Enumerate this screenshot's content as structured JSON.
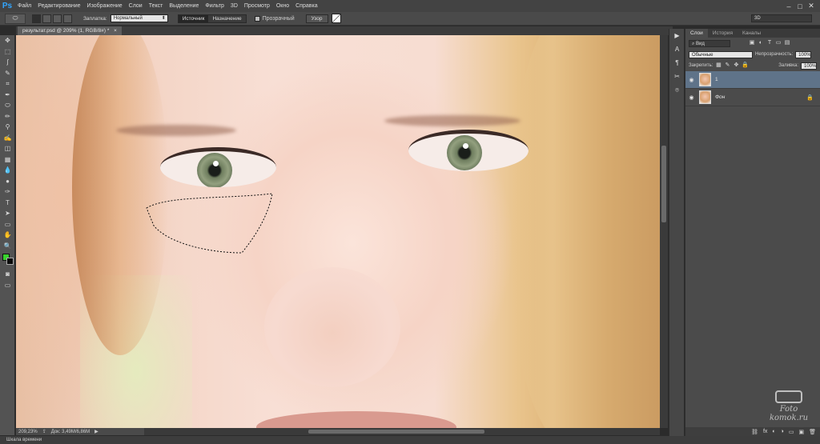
{
  "app": {
    "logo": "Ps"
  },
  "menu": [
    "Файл",
    "Редактирование",
    "Изображение",
    "Слои",
    "Текст",
    "Выделение",
    "Фильтр",
    "3D",
    "Просмотр",
    "Окно",
    "Справка"
  ],
  "window_controls": {
    "minimize": "–",
    "maximize": "□",
    "close": "✕"
  },
  "options": {
    "patch_label": "Заплатка:",
    "patch_mode": "Нормальный",
    "source": "Источник",
    "destination": "Назначение",
    "transparent": "Прозрачный",
    "pattern": "Узор",
    "workspace": "3D"
  },
  "document": {
    "tab_title": "результат.psd @ 209% (1, RGB/8#) *",
    "close": "×"
  },
  "status": {
    "zoom": "209,23%",
    "doc_size": "Док: 3,49M/6,86M",
    "arrow": "▶"
  },
  "timeline": {
    "label": "Шкала времени"
  },
  "layers_panel": {
    "tabs": [
      "Слои",
      "История",
      "Каналы"
    ],
    "active_tab": 0,
    "filter": "Вид",
    "blend_mode": "Обычные",
    "opacity_label": "Непрозрачность:",
    "opacity": "100%",
    "lock_label": "Закрепить:",
    "fill_label": "Заливка:",
    "fill": "100%",
    "layers": [
      {
        "name": "1",
        "selected": true,
        "locked": false
      },
      {
        "name": "Фон",
        "selected": false,
        "locked": true
      }
    ],
    "footer": [
      "fx",
      "◐",
      "◑",
      "▭",
      "▣",
      "🗑"
    ]
  },
  "tools": [
    "move-icon",
    "marquee-icon",
    "lasso-icon",
    "quick-select-icon",
    "crop-icon",
    "eyedropper-icon",
    "patch-icon",
    "brush-icon",
    "clone-stamp-icon",
    "history-brush-icon",
    "eraser-icon",
    "gradient-icon",
    "blur-icon",
    "dodge-icon",
    "pen-icon",
    "type-icon",
    "path-select-icon",
    "shape-icon",
    "hand-icon",
    "zoom-icon"
  ],
  "tool_glyphs": [
    "✥",
    "⬚",
    "ʃ",
    "✎",
    "⌗",
    "✒",
    "⬭",
    "✏",
    "⚲",
    "✍",
    "◫",
    "▦",
    "💧",
    "●",
    "✑",
    "T",
    "➤",
    "▭",
    "✋",
    "🔍"
  ],
  "colors": {
    "foreground": "#38d12c",
    "background": "#0a0a0a",
    "accent_selected_layer": "#5f7389",
    "app_logo": "#33a6ff"
  },
  "dock_glyphs": [
    "▶",
    "A",
    "¶",
    "✂",
    "⌾"
  ],
  "watermark": {
    "line1": "Foto",
    "line2": "komok.ru"
  }
}
